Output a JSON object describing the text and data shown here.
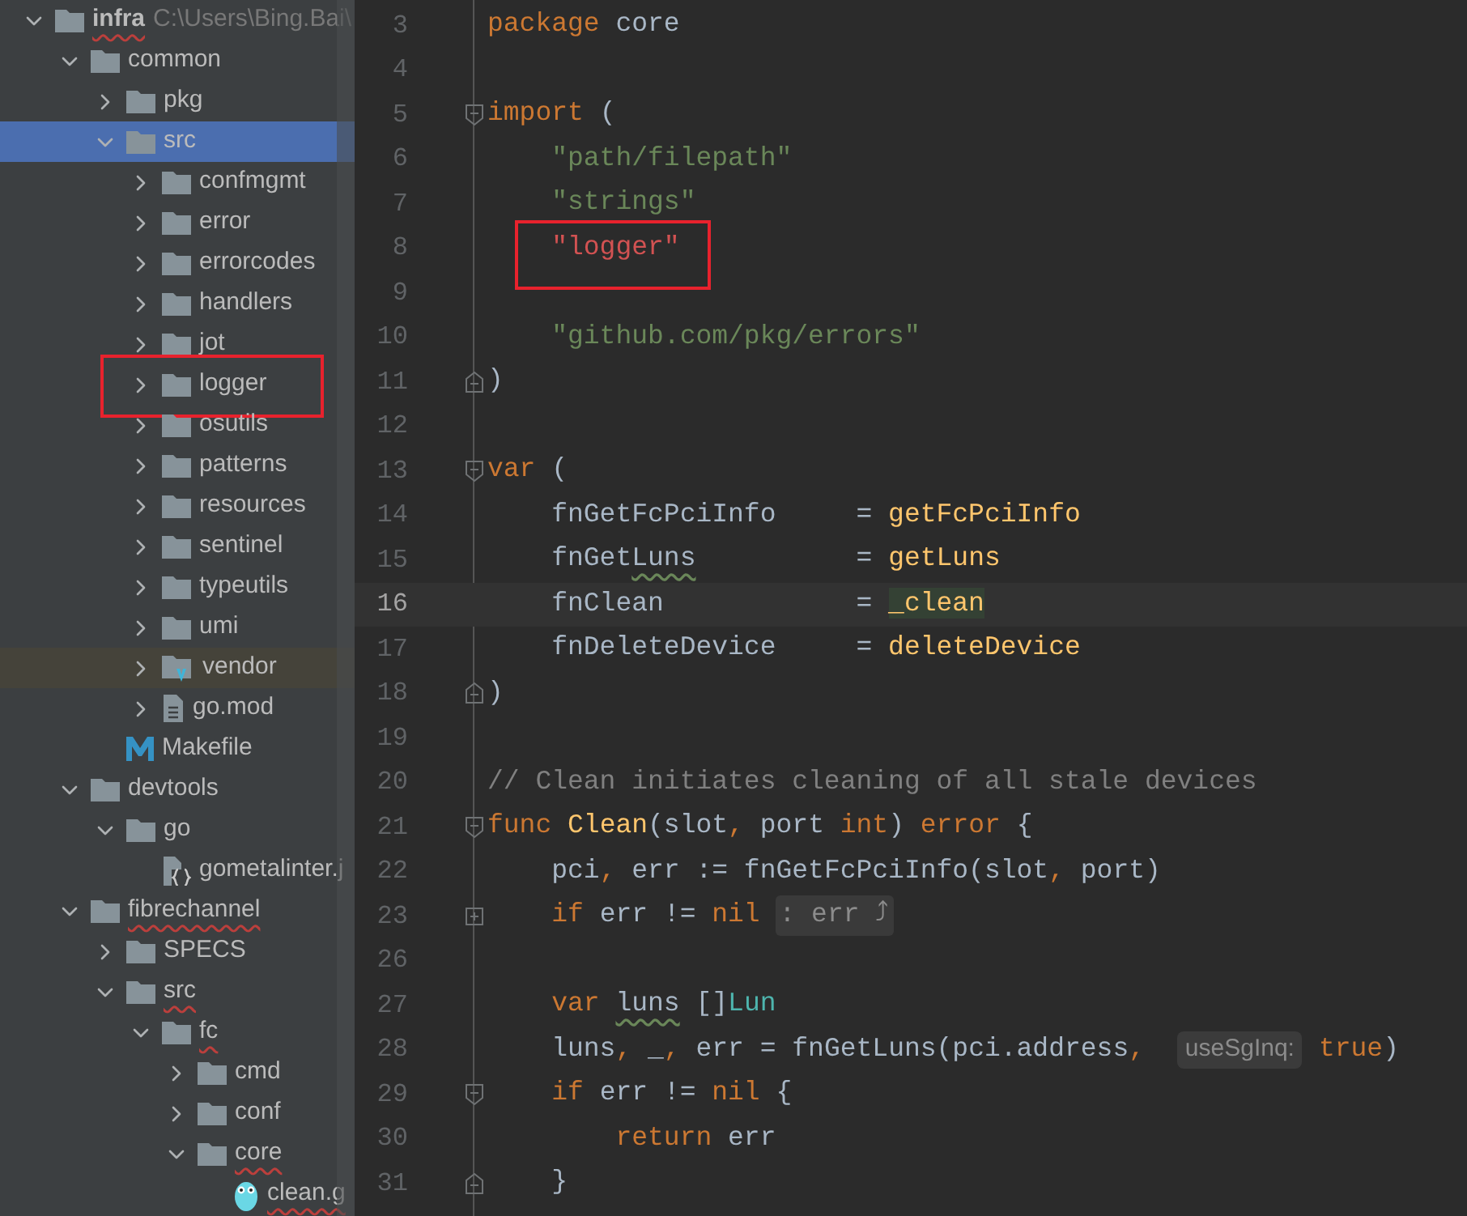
{
  "project_tree": {
    "items": [
      {
        "label": "infra",
        "hint": "C:\\Users\\Bing.Bai\\",
        "kind": "folder",
        "expanded": true,
        "selected": false,
        "underlined": true,
        "annotated": false,
        "bold": true,
        "children": [
          {
            "label": "common",
            "kind": "folder",
            "expanded": true,
            "selected": false,
            "underlined": false,
            "annotated": false,
            "bold": false,
            "children": [
              {
                "label": "pkg",
                "kind": "folder",
                "expanded": false,
                "selected": false,
                "underlined": false,
                "annotated": false,
                "bold": false
              },
              {
                "label": "src",
                "kind": "folder",
                "expanded": true,
                "selected": true,
                "underlined": false,
                "annotated": false,
                "bold": false,
                "children": [
                  {
                    "label": "confmgmt",
                    "kind": "folder",
                    "expanded": false,
                    "selected": false,
                    "underlined": false,
                    "annotated": false,
                    "bold": false
                  },
                  {
                    "label": "error",
                    "kind": "folder",
                    "expanded": false,
                    "selected": false,
                    "underlined": false,
                    "annotated": false,
                    "bold": false
                  },
                  {
                    "label": "errorcodes",
                    "kind": "folder",
                    "expanded": false,
                    "selected": false,
                    "underlined": false,
                    "annotated": false,
                    "bold": false
                  },
                  {
                    "label": "handlers",
                    "kind": "folder",
                    "expanded": false,
                    "selected": false,
                    "underlined": false,
                    "annotated": false,
                    "bold": false
                  },
                  {
                    "label": "jot",
                    "kind": "folder",
                    "expanded": false,
                    "selected": false,
                    "underlined": false,
                    "annotated": false,
                    "bold": false
                  },
                  {
                    "label": "logger",
                    "kind": "folder",
                    "expanded": false,
                    "selected": false,
                    "underlined": false,
                    "annotated": true,
                    "bold": false
                  },
                  {
                    "label": "osutils",
                    "kind": "folder",
                    "expanded": false,
                    "selected": false,
                    "underlined": false,
                    "annotated": false,
                    "bold": false
                  },
                  {
                    "label": "patterns",
                    "kind": "folder",
                    "expanded": false,
                    "selected": false,
                    "underlined": false,
                    "annotated": false,
                    "bold": false
                  },
                  {
                    "label": "resources",
                    "kind": "folder",
                    "expanded": false,
                    "selected": false,
                    "underlined": false,
                    "annotated": false,
                    "bold": false
                  },
                  {
                    "label": "sentinel",
                    "kind": "folder",
                    "expanded": false,
                    "selected": false,
                    "underlined": false,
                    "annotated": false,
                    "bold": false
                  },
                  {
                    "label": "typeutils",
                    "kind": "folder",
                    "expanded": false,
                    "selected": false,
                    "underlined": false,
                    "annotated": false,
                    "bold": false
                  },
                  {
                    "label": "umi",
                    "kind": "folder",
                    "expanded": false,
                    "selected": false,
                    "underlined": false,
                    "annotated": false,
                    "bold": false
                  },
                  {
                    "label": "vendor",
                    "kind": "vendor",
                    "expanded": false,
                    "selected": false,
                    "underlined": false,
                    "annotated": false,
                    "bold": false
                  },
                  {
                    "label": "go.mod",
                    "kind": "file",
                    "expanded": false,
                    "selected": false,
                    "underlined": false,
                    "annotated": false,
                    "bold": false
                  }
                ]
              },
              {
                "label": "Makefile",
                "kind": "makefile",
                "selected": false,
                "underlined": false,
                "annotated": false,
                "bold": false
              }
            ]
          },
          {
            "label": "devtools",
            "kind": "folder",
            "expanded": true,
            "selected": false,
            "underlined": false,
            "annotated": false,
            "bold": false,
            "children": [
              {
                "label": "go",
                "kind": "folder",
                "expanded": true,
                "selected": false,
                "underlined": false,
                "annotated": false,
                "bold": false,
                "children": [
                  {
                    "label": "gometalinter.j",
                    "kind": "json",
                    "selected": false,
                    "underlined": false,
                    "annotated": false,
                    "bold": false
                  }
                ]
              }
            ]
          },
          {
            "label": "fibrechannel",
            "kind": "folder",
            "expanded": true,
            "selected": false,
            "underlined": true,
            "annotated": false,
            "bold": false,
            "children": [
              {
                "label": "SPECS",
                "kind": "folder",
                "expanded": false,
                "selected": false,
                "underlined": false,
                "annotated": false,
                "bold": false
              },
              {
                "label": "src",
                "kind": "folder",
                "expanded": true,
                "selected": false,
                "underlined": true,
                "annotated": false,
                "bold": false,
                "children": [
                  {
                    "label": "fc",
                    "kind": "folder",
                    "expanded": true,
                    "selected": false,
                    "underlined": true,
                    "annotated": false,
                    "bold": false,
                    "children": [
                      {
                        "label": "cmd",
                        "kind": "folder",
                        "expanded": false,
                        "selected": false,
                        "underlined": false,
                        "annotated": false,
                        "bold": false
                      },
                      {
                        "label": "conf",
                        "kind": "folder",
                        "expanded": false,
                        "selected": false,
                        "underlined": false,
                        "annotated": false,
                        "bold": false
                      },
                      {
                        "label": "core",
                        "kind": "folder",
                        "expanded": true,
                        "selected": false,
                        "underlined": true,
                        "annotated": false,
                        "bold": false,
                        "children": [
                          {
                            "label": "clean.g",
                            "kind": "go",
                            "selected": false,
                            "underlined": true,
                            "annotated": false,
                            "bold": false
                          }
                        ]
                      }
                    ]
                  }
                ]
              }
            ]
          }
        ]
      }
    ]
  },
  "editor": {
    "lines": [
      {
        "number": "3",
        "current": false,
        "annotated": false,
        "segments": [
          {
            "text": "package ",
            "kind": "keyword"
          },
          {
            "text": "core",
            "kind": "plain"
          }
        ]
      },
      {
        "number": "4",
        "current": false,
        "annotated": false
      },
      {
        "number": "5",
        "current": false,
        "annotated": false,
        "gutter": {
          "kind": "fold_open"
        },
        "segments": [
          {
            "text": "import ",
            "kind": "keyword"
          },
          {
            "text": "(",
            "kind": "plain"
          }
        ]
      },
      {
        "number": "6",
        "current": false,
        "annotated": false,
        "segments": [
          {
            "text": "    \"path/filepath\"",
            "kind": "string"
          }
        ]
      },
      {
        "number": "7",
        "current": false,
        "annotated": false,
        "segments": [
          {
            "text": "    \"strings\"",
            "kind": "string"
          }
        ]
      },
      {
        "number": "8",
        "current": false,
        "annotated": true,
        "segments": [
          {
            "text": "    \"logger\"",
            "kind": "error_string"
          }
        ]
      },
      {
        "number": "9",
        "current": false,
        "annotated": false
      },
      {
        "number": "10",
        "current": false,
        "annotated": false,
        "segments": [
          {
            "text": "    \"github.com/pkg/errors\"",
            "kind": "string"
          }
        ]
      },
      {
        "number": "11",
        "current": false,
        "annotated": false,
        "gutter": {
          "kind": "fold_close"
        },
        "segments": [
          {
            "text": ")",
            "kind": "plain"
          }
        ]
      },
      {
        "number": "12",
        "current": false,
        "annotated": false
      },
      {
        "number": "13",
        "current": false,
        "annotated": false,
        "gutter": {
          "kind": "fold_open"
        },
        "segments": [
          {
            "text": "var ",
            "kind": "keyword"
          },
          {
            "text": "(",
            "kind": "plain"
          }
        ]
      },
      {
        "number": "14",
        "current": false,
        "annotated": false,
        "segments": [
          {
            "text": "    fnGetFcPciInfo     = ",
            "kind": "plain"
          },
          {
            "text": "getFcPciInfo",
            "kind": "function"
          }
        ]
      },
      {
        "number": "15",
        "current": false,
        "annotated": false,
        "segments": [
          {
            "text": "    fnGet",
            "kind": "plain"
          },
          {
            "text": "Luns",
            "kind": "typo"
          },
          {
            "text": "          = ",
            "kind": "plain"
          },
          {
            "text": "getLuns",
            "kind": "function"
          }
        ]
      },
      {
        "number": "16",
        "current": true,
        "annotated": false,
        "segments": [
          {
            "text": "    fnClean            = ",
            "kind": "plain"
          },
          {
            "text": "_clean",
            "kind": "function_match"
          }
        ]
      },
      {
        "number": "17",
        "current": false,
        "annotated": false,
        "segments": [
          {
            "text": "    fnDeleteDevice     = ",
            "kind": "plain"
          },
          {
            "text": "deleteDevice",
            "kind": "function"
          }
        ]
      },
      {
        "number": "18",
        "current": false,
        "annotated": false,
        "gutter": {
          "kind": "fold_close"
        },
        "segments": [
          {
            "text": ")",
            "kind": "plain"
          }
        ]
      },
      {
        "number": "19",
        "current": false,
        "annotated": false
      },
      {
        "number": "20",
        "current": false,
        "annotated": false,
        "segments": [
          {
            "text": "// Clean initiates cleaning of all stale devices",
            "kind": "comment"
          }
        ]
      },
      {
        "number": "21",
        "current": false,
        "annotated": false,
        "gutter": {
          "kind": "fold_open"
        },
        "segments": [
          {
            "text": "func ",
            "kind": "keyword"
          },
          {
            "text": "Clean",
            "kind": "function"
          },
          {
            "text": "(slot",
            "kind": "plain"
          },
          {
            "text": ", ",
            "kind": "keyword"
          },
          {
            "text": "port ",
            "kind": "plain"
          },
          {
            "text": "int",
            "kind": "keyword"
          },
          {
            "text": ") ",
            "kind": "plain"
          },
          {
            "text": "error ",
            "kind": "keyword"
          },
          {
            "text": "{",
            "kind": "plain"
          }
        ]
      },
      {
        "number": "22",
        "current": false,
        "annotated": false,
        "segments": [
          {
            "text": "    pci",
            "kind": "plain"
          },
          {
            "text": ", ",
            "kind": "keyword"
          },
          {
            "text": "err := fnGetFcPciInfo(slot",
            "kind": "plain"
          },
          {
            "text": ", ",
            "kind": "keyword"
          },
          {
            "text": "port)",
            "kind": "plain"
          }
        ]
      },
      {
        "number": "23",
        "current": false,
        "annotated": false,
        "gutter": {
          "kind": "fold_collapsed"
        },
        "segments": [
          {
            "text": "    if ",
            "kind": "keyword"
          },
          {
            "text": "err != ",
            "kind": "plain"
          },
          {
            "text": "nil ",
            "kind": "keyword"
          },
          {
            "text": ": err ⤴",
            "kind": "folded_hint"
          }
        ]
      },
      {
        "number": "26",
        "current": false,
        "annotated": false
      },
      {
        "number": "27",
        "current": false,
        "annotated": false,
        "segments": [
          {
            "text": "    var ",
            "kind": "keyword"
          },
          {
            "text": "luns",
            "kind": "typo"
          },
          {
            "text": " []",
            "kind": "plain"
          },
          {
            "text": "Lun",
            "kind": "type"
          }
        ]
      },
      {
        "number": "28",
        "current": false,
        "annotated": false,
        "segments": [
          {
            "text": "    luns",
            "kind": "plain"
          },
          {
            "text": ", ",
            "kind": "keyword"
          },
          {
            "text": "_",
            "kind": "plain"
          },
          {
            "text": ", ",
            "kind": "keyword"
          },
          {
            "text": "err = fnGetLuns(pci.address",
            "kind": "plain"
          },
          {
            "text": ", ",
            "kind": "keyword"
          },
          {
            "text": "useSgInq:",
            "kind": "param_hint"
          },
          {
            "text": "true",
            "kind": "keyword"
          },
          {
            "text": ")",
            "kind": "plain"
          }
        ]
      },
      {
        "number": "29",
        "current": false,
        "annotated": false,
        "gutter": {
          "kind": "fold_open"
        },
        "segments": [
          {
            "text": "    if ",
            "kind": "keyword"
          },
          {
            "text": "err != ",
            "kind": "plain"
          },
          {
            "text": "nil ",
            "kind": "keyword"
          },
          {
            "text": "{",
            "kind": "plain"
          }
        ]
      },
      {
        "number": "30",
        "current": false,
        "annotated": false,
        "segments": [
          {
            "text": "        return ",
            "kind": "keyword"
          },
          {
            "text": "err",
            "kind": "plain"
          }
        ]
      },
      {
        "number": "31",
        "current": false,
        "annotated": false,
        "gutter": {
          "kind": "fold_close"
        },
        "segments": [
          {
            "text": "    }",
            "kind": "plain"
          }
        ]
      }
    ]
  }
}
